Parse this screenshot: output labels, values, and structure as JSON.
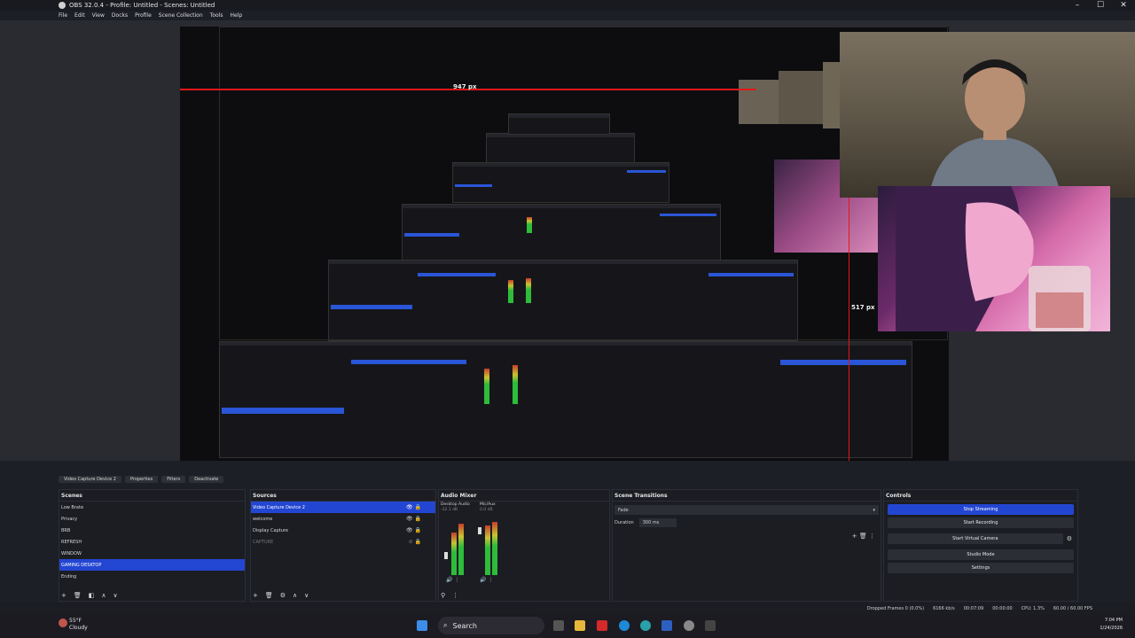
{
  "window": {
    "title": "OBS 32.0.4 - Profile: Untitled - Scenes: Untitled",
    "controls": [
      "–",
      "☐",
      "✕"
    ]
  },
  "menu": [
    "File",
    "Edit",
    "View",
    "Docks",
    "Profile",
    "Scene Collection",
    "Tools",
    "Help"
  ],
  "preview": {
    "measure_labels": [
      "947 px",
      "517 px"
    ]
  },
  "source_toolbar": {
    "source_name": "Video Capture Device 2",
    "properties": "Properties",
    "filters": "Filters",
    "deactivate": "Deactivate"
  },
  "scenes": {
    "title": "Scenes",
    "items": [
      "Low Brate",
      "Privacy",
      "BRB",
      "REFRESH",
      "WINDOW",
      "GAMING DESKTOP",
      "Ending"
    ],
    "selected": "GAMING DESKTOP"
  },
  "sources": {
    "title": "Sources",
    "items": [
      "Video Capture Device 2",
      "welcome",
      "Display Capture",
      "CAPTURE"
    ],
    "selected": "Video Capture Device 2"
  },
  "audio_mixer": {
    "title": "Audio Mixer",
    "channels": [
      {
        "name": "Desktop Audio",
        "level": "-32.1 dB"
      },
      {
        "name": "Mic/Aux",
        "level": "0.0 dB"
      }
    ]
  },
  "scene_transitions": {
    "title": "Scene Transitions",
    "transition": "Fade",
    "duration_label": "Duration",
    "duration_value": "300 ms"
  },
  "controls": {
    "title": "Controls",
    "stop_streaming": "Stop Streaming",
    "start_recording": "Start Recording",
    "start_virtual_camera": "Start Virtual Camera",
    "studio_mode": "Studio Mode",
    "settings": "Settings"
  },
  "status": {
    "dropped_frames": "Dropped Frames 0 (0.0%)",
    "bitrate": "6166 kb/s",
    "stream_time": "00:07:09",
    "record_time": "00:00:00",
    "cpu": "CPU: 1.3%",
    "fps": "60.00 / 60.00 FPS"
  },
  "taskbar": {
    "temp": "55°F",
    "condition": "Cloudy",
    "search_placeholder": "Search",
    "time": "7:04 PM",
    "date": "1/24/2026"
  },
  "colors": {
    "accent": "#2346d2",
    "stream_red": "#e01818",
    "meter_green": "#2ebc3a"
  }
}
